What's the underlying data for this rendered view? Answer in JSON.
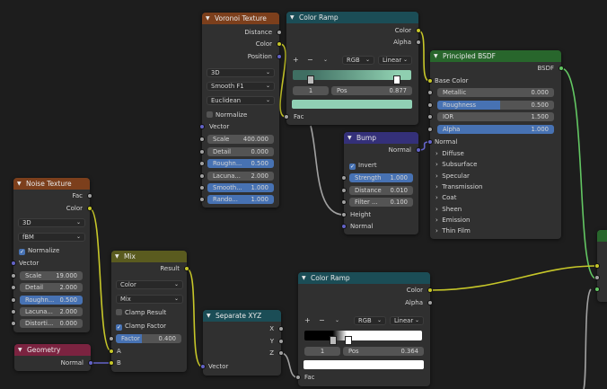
{
  "voronoi": {
    "title": "Voronoi Texture",
    "outputs": [
      "Distance",
      "Color",
      "Position"
    ],
    "dims": "3D",
    "feature": "Smooth F1",
    "metric": "Euclidean",
    "normalize": "Normalize",
    "input_vector": "Vector",
    "fields": [
      {
        "label": "Scale",
        "value": "400.000"
      },
      {
        "label": "Detail",
        "value": "0.000"
      },
      {
        "label": "Roughn...",
        "value": "0.500"
      },
      {
        "label": "Lacuna...",
        "value": "2.000"
      },
      {
        "label": "Smooth...",
        "value": "1.000"
      },
      {
        "label": "Rando...",
        "value": "1.000"
      }
    ]
  },
  "ramp1": {
    "title": "Color Ramp",
    "out_color": "Color",
    "out_alpha": "Alpha",
    "mode": "RGB",
    "interp": "Linear",
    "index": "1",
    "pos_label": "Pos",
    "pos_value": "0.877",
    "input": "Fac",
    "colors": {
      "left": "#3f6e62",
      "right": "#8fcfb0",
      "swatch": "#90d0b4"
    }
  },
  "bsdf": {
    "title": "Principled BSDF",
    "output": "BSDF",
    "base_color": "Base Color",
    "fields": [
      {
        "label": "Metallic",
        "value": "0.000",
        "fill": 0
      },
      {
        "label": "Roughness",
        "value": "0.500",
        "fill": 0.5
      },
      {
        "label": "IOR",
        "value": "1.500",
        "fill": 0
      },
      {
        "label": "Alpha",
        "value": "1.000",
        "fill": 1
      }
    ],
    "normal": "Normal",
    "panels": [
      "Diffuse",
      "Subsurface",
      "Specular",
      "Transmission",
      "Coat",
      "Sheen",
      "Emission",
      "Thin Film"
    ]
  },
  "bump": {
    "title": "Bump",
    "output": "Normal",
    "invert": "Invert",
    "fields": [
      {
        "label": "Strength",
        "value": "1.000"
      },
      {
        "label": "Distance",
        "value": "0.010"
      },
      {
        "label": "Filter ...",
        "value": "0.100"
      }
    ],
    "height": "Height",
    "normal": "Normal"
  },
  "noise": {
    "title": "Noise Texture",
    "outputs": [
      "Fac",
      "Color"
    ],
    "dims": "3D",
    "type": "fBM",
    "normalize": "Normalize",
    "input_vector": "Vector",
    "fields": [
      {
        "label": "Scale",
        "value": "19.000"
      },
      {
        "label": "Detail",
        "value": "2.000"
      },
      {
        "label": "Roughn...",
        "value": "0.500"
      },
      {
        "label": "Lacuna...",
        "value": "2.000"
      },
      {
        "label": "Distorti...",
        "value": "0.000"
      }
    ]
  },
  "geometry": {
    "title": "Geometry",
    "output": "Normal"
  },
  "mix": {
    "title": "Mix",
    "output": "Result",
    "data_type": "Color",
    "blend": "Mix",
    "clamp_result": "Clamp Result",
    "clamp_factor": "Clamp Factor",
    "factor_label": "Factor",
    "factor_value": "0.400",
    "input_a": "A",
    "input_b": "B"
  },
  "sepxyz": {
    "title": "Separate XYZ",
    "outputs": [
      "X",
      "Y",
      "Z"
    ],
    "input": "Vector"
  },
  "ramp2": {
    "title": "Color Ramp",
    "out_color": "Color",
    "out_alpha": "Alpha",
    "mode": "RGB",
    "interp": "Linear",
    "index": "1",
    "pos_label": "Pos",
    "pos_value": "0.364",
    "input": "Fac",
    "colors": {
      "left": "#000000",
      "right": "#ffffff",
      "swatch": "#ffffff"
    }
  },
  "wire_colors": {
    "color": "#c7c729",
    "float": "#a1a1a1",
    "vector": "#6363c7",
    "shader": "#63c763"
  }
}
